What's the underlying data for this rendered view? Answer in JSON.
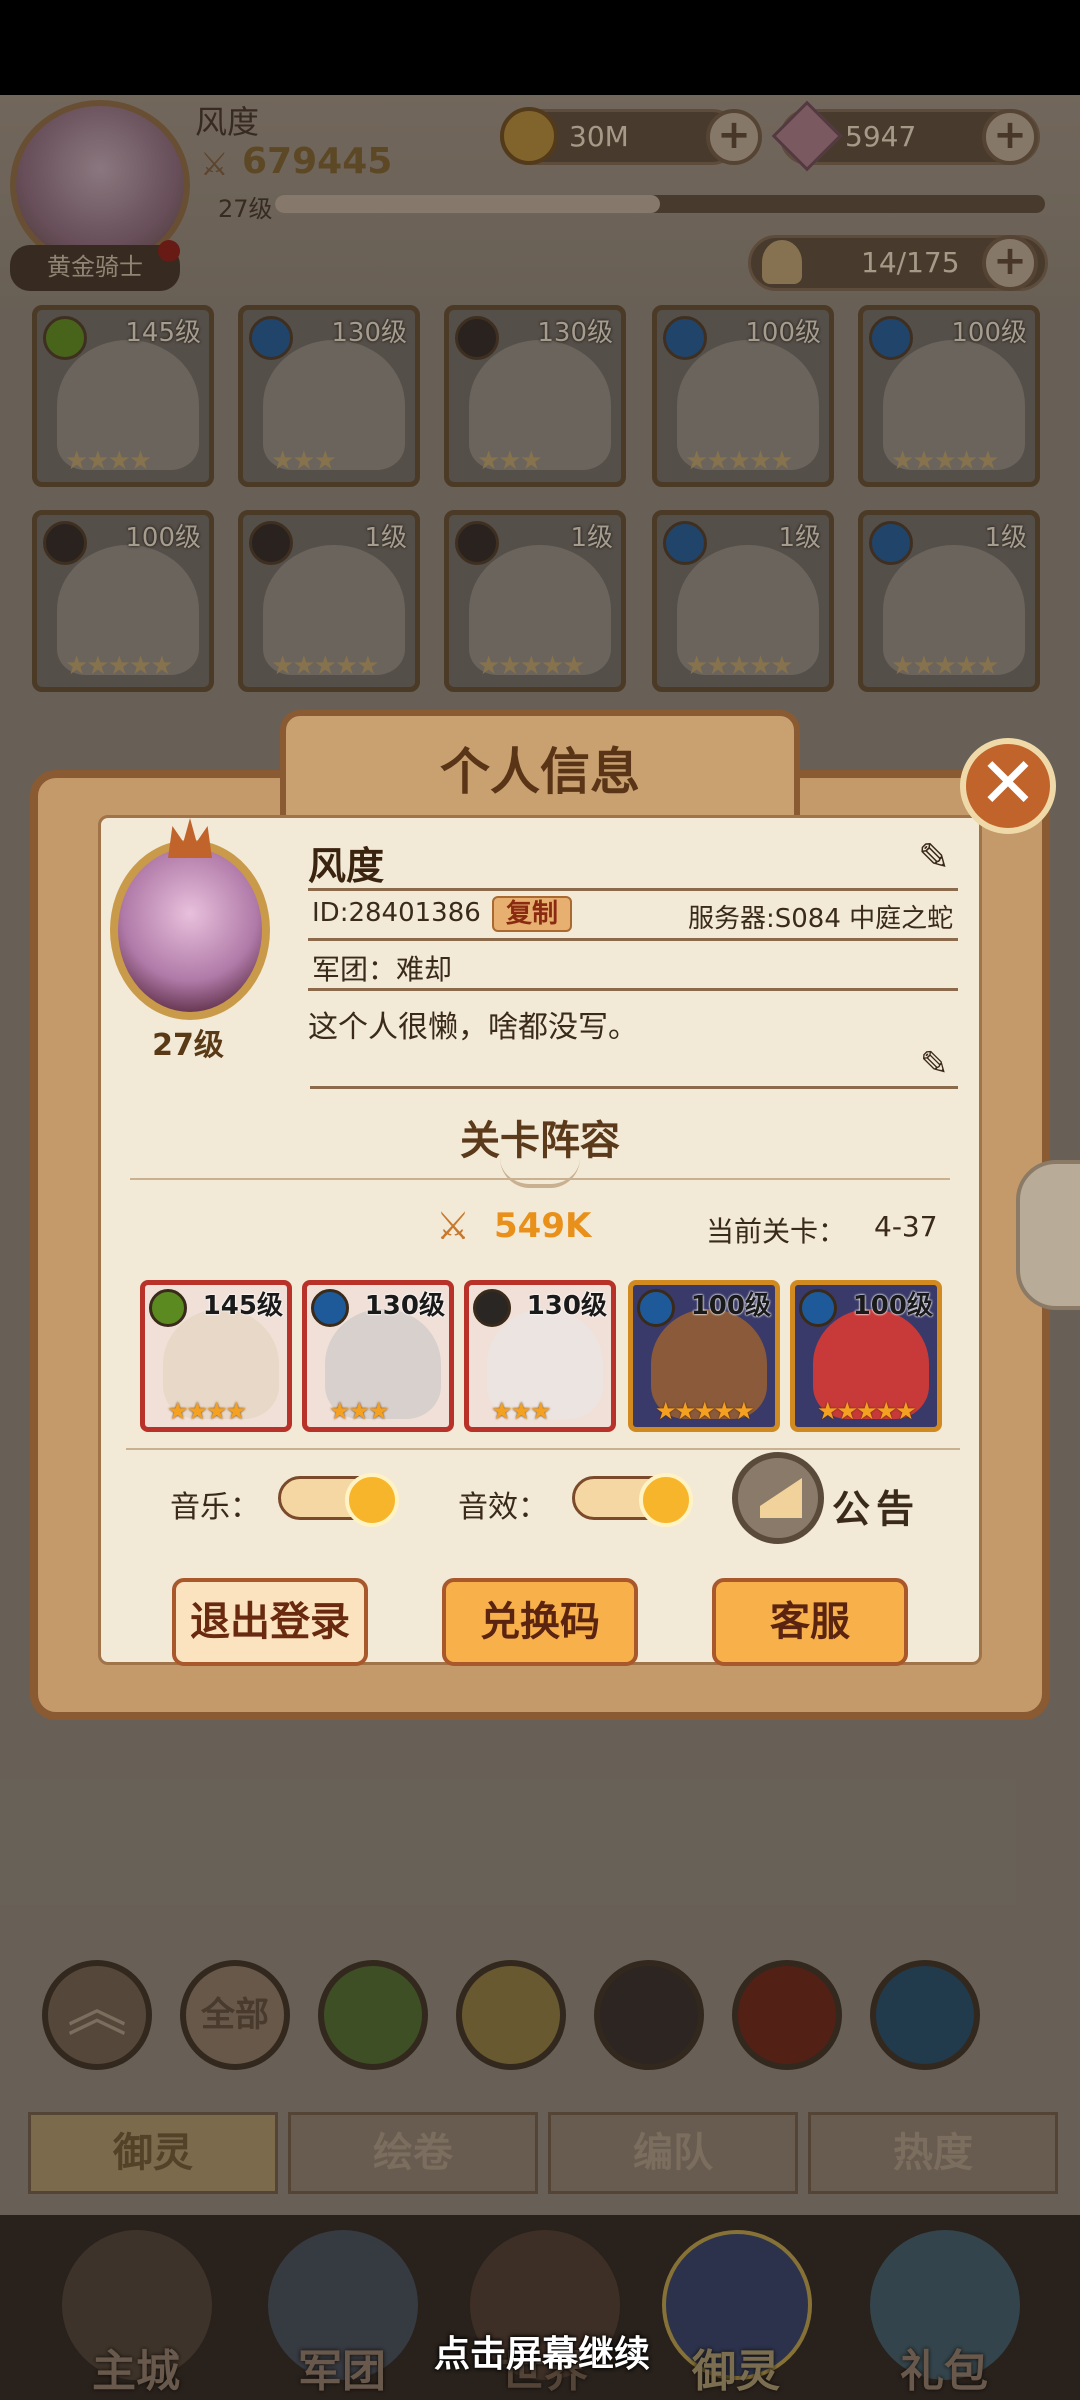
{
  "player": {
    "name": "风度",
    "power": "679445",
    "level": "27级",
    "rank_title": "黄金骑士",
    "level_progress": 0.5
  },
  "resources": {
    "gold": "30M",
    "gems": "5947",
    "roster": "14/175"
  },
  "roster_cards": [
    {
      "level": "145级",
      "element": "nature",
      "stars": "★★★★"
    },
    {
      "level": "130级",
      "element": "water",
      "stars": "★★★"
    },
    {
      "level": "130级",
      "element": "dark",
      "stars": "★★★"
    },
    {
      "level": "100级",
      "element": "water",
      "stars": "★★★★★"
    },
    {
      "level": "100级",
      "element": "water",
      "stars": "★★★★★"
    },
    {
      "level": "100级",
      "element": "dark",
      "stars": "★★★★★"
    },
    {
      "level": "1级",
      "element": "dark",
      "stars": "★★★★★"
    },
    {
      "level": "1级",
      "element": "dark",
      "stars": "★★★★★"
    },
    {
      "level": "1级",
      "element": "water",
      "stars": "★★★★★"
    },
    {
      "level": "1级",
      "element": "water",
      "stars": "★★★★★"
    }
  ],
  "popup": {
    "title": "个人信息",
    "name": "风度",
    "id_text": "ID:28401386",
    "copy_label": "复制",
    "server": "服务器:S084 中庭之蛇",
    "legion": "军团：难却",
    "signature": "这个人很懒，啥都没写。",
    "avatar_level": "27级",
    "lineup_title": "关卡阵容",
    "lineup_power": "549K",
    "stage_label": "当前关卡：",
    "stage_value": "4-37",
    "heroes": [
      {
        "level": "145级",
        "element": "nature",
        "stars": "★★★★",
        "frame": "#b8322a"
      },
      {
        "level": "130级",
        "element": "water",
        "stars": "★★★",
        "frame": "#b8322a"
      },
      {
        "level": "130级",
        "element": "dark",
        "stars": "★★★",
        "frame": "#b8322a"
      },
      {
        "level": "100级",
        "element": "water",
        "stars": "★★★★★",
        "frame": "#d08a20"
      },
      {
        "level": "100级",
        "element": "water",
        "stars": "★★★★★",
        "frame": "#d08a20"
      }
    ],
    "music_label": "音乐：",
    "sfx_label": "音效：",
    "notice_label": "公告",
    "logout_label": "退出登录",
    "redeem_label": "兑换码",
    "service_label": "客服"
  },
  "filters": [
    "全部"
  ],
  "bottom_tabs": [
    "御灵",
    "绘卷",
    "编队",
    "热度"
  ],
  "nav": [
    "主城",
    "军团",
    "世界",
    "御灵",
    "礼包"
  ],
  "continue_hint": "点击屏幕继续",
  "colors": {
    "accent_orange": "#f7b52c",
    "frame_brown": "#8a5a32",
    "panel_cream": "#f3e9d7",
    "close_red": "#c1642c"
  }
}
